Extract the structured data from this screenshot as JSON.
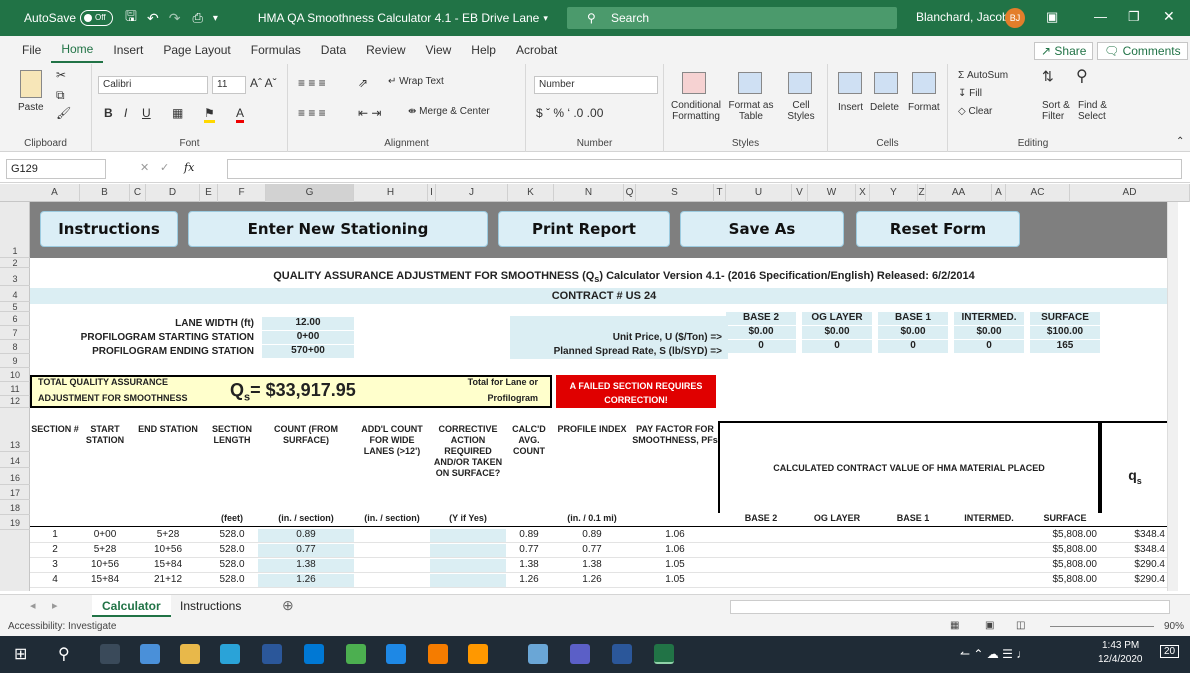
{
  "titlebar": {
    "autosave": "AutoSave",
    "toggle": "Off",
    "doc_title": "HMA QA Smoothness Calculator 4.1 - EB Drive Lane",
    "search": "Search",
    "user": "Blanchard, Jacob",
    "initials": "BJ"
  },
  "ribbon_tabs": [
    "File",
    "Home",
    "Insert",
    "Page Layout",
    "Formulas",
    "Data",
    "Review",
    "View",
    "Help",
    "Acrobat"
  ],
  "share": "Share",
  "comments": "Comments",
  "ribbon": {
    "paste": "Paste",
    "font_name": "Calibri",
    "font_size": "11",
    "wrap_text": "Wrap Text",
    "merge_center": "Merge & Center",
    "number_format": "Number",
    "conditional_formatting": "Conditional Formatting",
    "format_as_table": "Format as Table",
    "cell_styles": "Cell Styles",
    "insert": "Insert",
    "delete": "Delete",
    "format": "Format",
    "autosum": "AutoSum",
    "fill": "Fill",
    "clear": "Clear",
    "sort_filter": "Sort & Filter",
    "find_select": "Find & Select",
    "groups": {
      "clipboard": "Clipboard",
      "font": "Font",
      "alignment": "Alignment",
      "number": "Number",
      "styles": "Styles",
      "cells": "Cells",
      "editing": "Editing"
    }
  },
  "formula_bar": {
    "name_box": "G129",
    "fx": "fx",
    "content": ""
  },
  "columns": [
    "A",
    "B",
    "C",
    "D",
    "E",
    "F",
    "G",
    "H",
    "I",
    "J",
    "K",
    "N",
    "Q",
    "S",
    "T",
    "U",
    "V",
    "W",
    "X",
    "Y",
    "Z",
    "AA",
    "A",
    "AC",
    "AD"
  ],
  "rows": [
    "1",
    "2",
    "3",
    "4",
    "5",
    "6",
    "7",
    "8",
    "9",
    "10",
    "11",
    "12",
    "13",
    "14",
    "16",
    "17",
    "18",
    "19"
  ],
  "buttons": {
    "instructions": "Instructions",
    "enter_new_stationing": "Enter New Stationing",
    "print_report": "Print Report",
    "save_as": "Save As",
    "reset_form": "Reset Form"
  },
  "sheet": {
    "title": "QUALITY ASSURANCE ADJUSTMENT FOR SMOOTHNESS (Q",
    "title_sub": "s",
    "title_rest": ") Calculator Version 4.1- (2016 Specification/English) Released: 6/2/2014",
    "contract": "CONTRACT # US 24",
    "lane_width_label": "LANE WIDTH (ft)",
    "lane_width": "12.00",
    "start_station_label": "PROFILOGRAM STARTING STATION",
    "start_station": "0+00",
    "end_station_label": "PROFILOGRAM ENDING STATION",
    "end_station": "570+00",
    "unit_price_label": "Unit Price, U ($/Ton) =>",
    "spread_rate_label": "Planned Spread Rate, S (lb/SYD) =>",
    "material_cols": [
      "BASE 2",
      "OG LAYER",
      "BASE 1",
      "INTERMED.",
      "SURFACE"
    ],
    "unit_prices": [
      "$0.00",
      "$0.00",
      "$0.00",
      "$0.00",
      "$100.00"
    ],
    "spread_rates": [
      "0",
      "0",
      "0",
      "0",
      "165"
    ],
    "total_label_1": "TOTAL QUALITY ASSURANCE",
    "total_label_2": "ADJUSTMENT FOR SMOOTHNESS",
    "qs_label": "Q",
    "qs_sub": "s",
    "qs_value": "= $33,917.95",
    "total_for_1": "Total for Lane or",
    "total_for_2": "Profilogram",
    "failed_1": "A FAILED SECTION REQUIRES",
    "failed_2": "CORRECTION!",
    "headers": {
      "section": "SECTION #",
      "start": "START STATION",
      "end": "END STATION",
      "length": "SECTION LENGTH",
      "count": "COUNT (FROM SURFACE)",
      "addl": "ADD'L COUNT FOR WIDE LANES (>12')",
      "corrective": "CORRECTIVE ACTION REQUIRED AND/OR TAKEN ON SURFACE?",
      "calcd": "CALC'D AVG. COUNT",
      "profile": "PROFILE INDEX",
      "payfactor": "PAY FACTOR FOR SMOOTHNESS, PFs",
      "contract_value": "CALCULATED CONTRACT VALUE OF HMA MATERIAL PLACED",
      "qs": "q",
      "qs_sub": "s"
    },
    "units": {
      "length": "(feet)",
      "count": "(in. / section)",
      "addl": "(in. / section)",
      "corrective": "(Y if Yes)",
      "profile": "(in. / 0.1 mi)"
    },
    "data_rows": [
      {
        "row": "16",
        "section": "1",
        "start": "0+00",
        "end": "5+28",
        "length": "528.0",
        "count": "0.89",
        "calcd": "0.89",
        "profile": "0.89",
        "pf": "1.06",
        "surface": "$5,808.00",
        "qs": "$348.4"
      },
      {
        "row": "17",
        "section": "2",
        "start": "5+28",
        "end": "10+56",
        "length": "528.0",
        "count": "0.77",
        "calcd": "0.77",
        "profile": "0.77",
        "pf": "1.06",
        "surface": "$5,808.00",
        "qs": "$348.4"
      },
      {
        "row": "18",
        "section": "3",
        "start": "10+56",
        "end": "15+84",
        "length": "528.0",
        "count": "1.38",
        "calcd": "1.38",
        "profile": "1.38",
        "pf": "1.05",
        "surface": "$5,808.00",
        "qs": "$290.4"
      },
      {
        "row": "19",
        "section": "4",
        "start": "15+84",
        "end": "21+12",
        "length": "528.0",
        "count": "1.26",
        "calcd": "1.26",
        "profile": "1.26",
        "pf": "1.05",
        "surface": "$5,808.00",
        "qs": "$290.4"
      }
    ]
  },
  "sheet_tabs": [
    "Calculator",
    "Instructions"
  ],
  "status": {
    "accessibility": "Accessibility: Investigate",
    "zoom": "90%"
  },
  "taskbar": {
    "time": "1:43 PM",
    "date": "12/4/2020",
    "notifications": "20"
  }
}
